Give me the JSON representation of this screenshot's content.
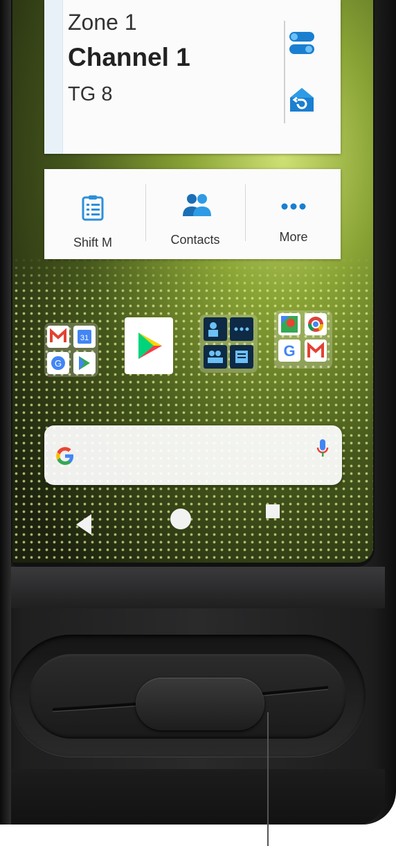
{
  "channel_card": {
    "zone": "Zone 1",
    "channel": "Channel 1",
    "talkgroup": "TG 8"
  },
  "shortcuts": [
    {
      "label": "Shift M",
      "icon": "clipboard-list-icon"
    },
    {
      "label": "Contacts",
      "icon": "contacts-icon"
    },
    {
      "label": "More",
      "icon": "more-dots-icon"
    }
  ],
  "home_apps": [
    {
      "icon": "google-apps-folder-icon"
    },
    {
      "icon": "play-store-icon"
    },
    {
      "icon": "radio-apps-folder-icon"
    },
    {
      "icon": "google-maps-folder-icon"
    }
  ],
  "search_bar": {
    "icon": "google-g-icon",
    "mic": "mic-icon"
  },
  "nav": [
    "back-icon",
    "home-icon",
    "recents-icon"
  ],
  "colors": {
    "accent_blue": "#1a7fd0",
    "wallpaper_green": "#8fa93a"
  }
}
